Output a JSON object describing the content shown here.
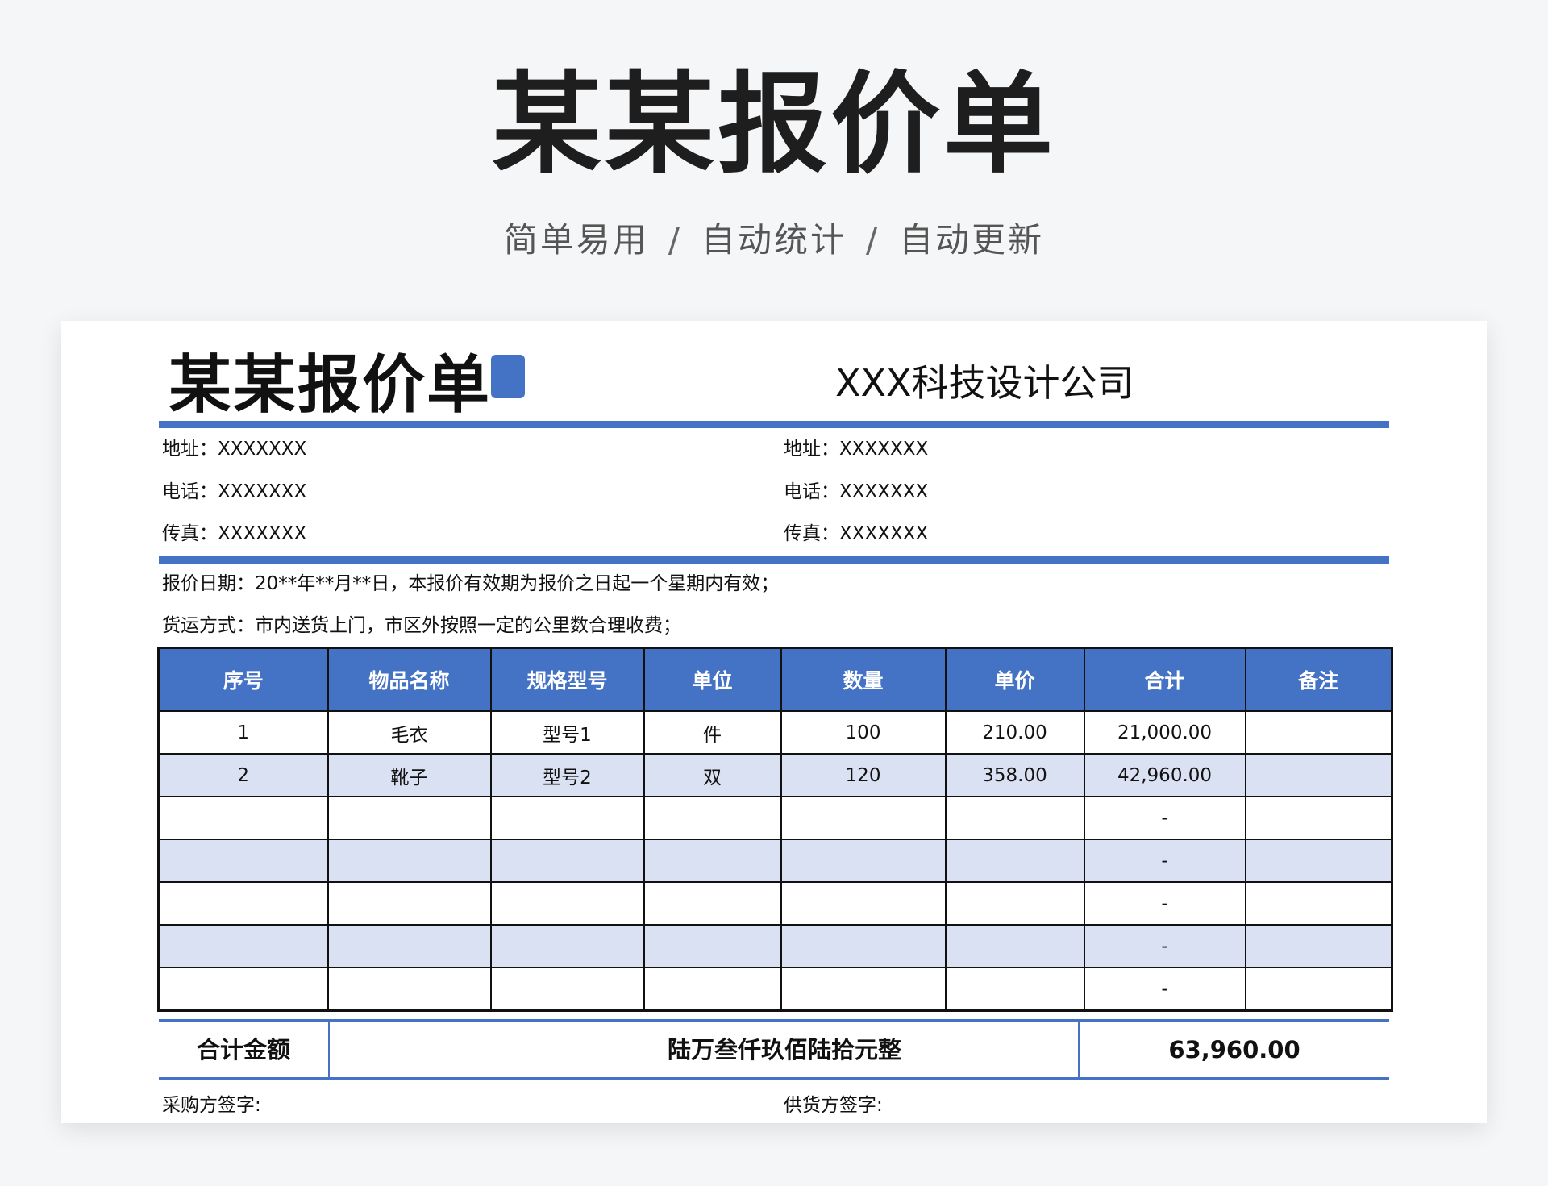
{
  "hero": {
    "title": "某某报价单",
    "tagline": [
      "简单易用",
      "自动统计",
      "自动更新"
    ],
    "separator": "/"
  },
  "accent_color": "#4472c4",
  "row_alt_color": "#d9e1f2",
  "document": {
    "title": "某某报价单",
    "company": "XXX科技设计公司",
    "left_info": {
      "address": "地址：XXXXXXX",
      "phone": "电话：XXXXXXX",
      "fax": "传真：XXXXXXX"
    },
    "right_info": {
      "address": "地址：XXXXXXX",
      "phone": "电话：XXXXXXX",
      "fax": "传真：XXXXXXX"
    },
    "quote_date_note": "报价日期：20**年**月**日，本报价有效期为报价之日起一个星期内有效；",
    "shipping_note": "货运方式：市内送货上门，市区外按照一定的公里数合理收费；",
    "table": {
      "headers": [
        "序号",
        "物品名称",
        "规格型号",
        "单位",
        "数量",
        "单价",
        "合计",
        "备注"
      ],
      "rows": [
        [
          "1",
          "毛衣",
          "型号1",
          "件",
          "100",
          "210.00",
          "21,000.00",
          ""
        ],
        [
          "2",
          "靴子",
          "型号2",
          "双",
          "120",
          "358.00",
          "42,960.00",
          ""
        ],
        [
          "",
          "",
          "",
          "",
          "",
          "",
          "-",
          ""
        ],
        [
          "",
          "",
          "",
          "",
          "",
          "",
          "-",
          ""
        ],
        [
          "",
          "",
          "",
          "",
          "",
          "",
          "-",
          ""
        ],
        [
          "",
          "",
          "",
          "",
          "",
          "",
          "-",
          ""
        ],
        [
          "",
          "",
          "",
          "",
          "",
          "",
          "-",
          ""
        ]
      ]
    },
    "total": {
      "label": "合计金额",
      "amount_in_words": "陆万叁仟玖佰陆拾元整",
      "amount": "63,960.00"
    },
    "signatures": {
      "buyer": "采购方签字:",
      "supplier": "供货方签字:"
    }
  }
}
